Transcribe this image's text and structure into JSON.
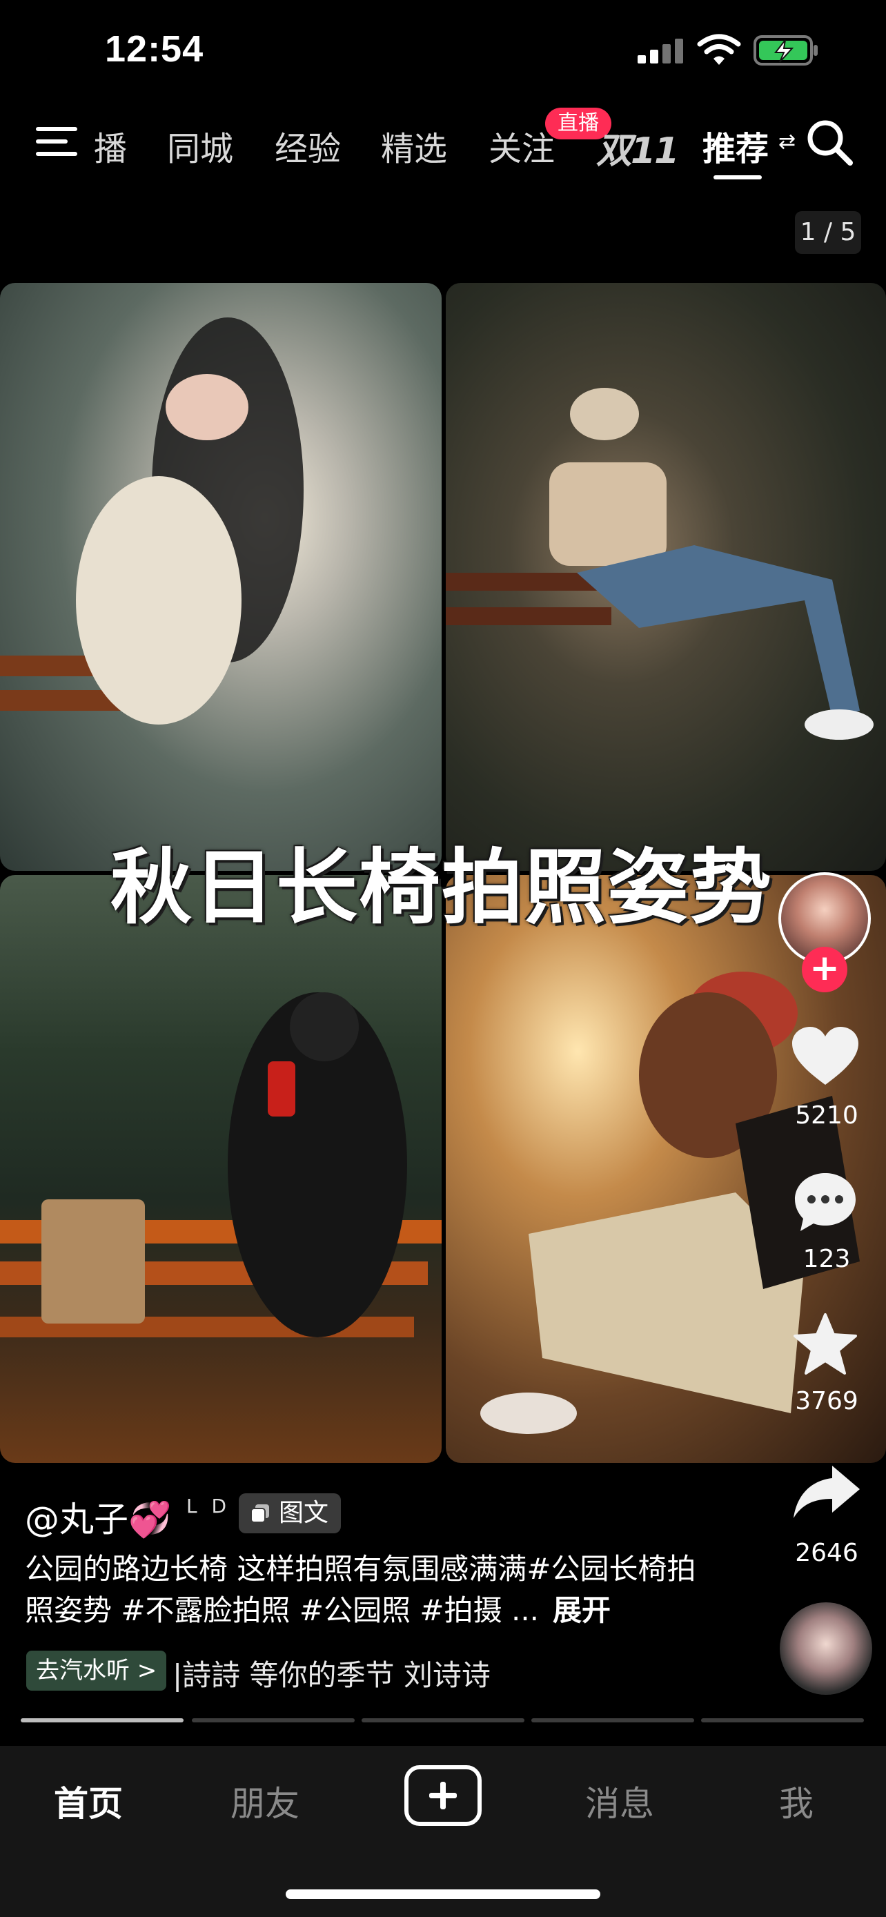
{
  "status_bar": {
    "time": "12:54"
  },
  "top_nav": {
    "tabs": [
      {
        "label": "播"
      },
      {
        "label": "同城"
      },
      {
        "label": "经验"
      },
      {
        "label": "精选"
      },
      {
        "label": "关注"
      },
      {
        "label": "推荐"
      }
    ],
    "live_badge": "直播",
    "promo_label": "双11",
    "active_tab": "推荐"
  },
  "post": {
    "page_counter": "1 / 5",
    "overlay_title": "秋日长椅拍照姿势",
    "author_name": "@丸子💞",
    "author_tag": "L D",
    "post_type": "图文",
    "caption": "公园的路边长椅 这样拍照有氛围感满满#公园长椅拍照姿势 #不露脸拍照 #公园照 #拍摄 ...",
    "caption_more": "展开",
    "music_link": "去汽水听 >",
    "music_title": "|詩詩  等你的季节 刘诗诗",
    "progress": {
      "segments": 5,
      "current": 1
    }
  },
  "actions": {
    "likes": "5210",
    "comments": "123",
    "favorites": "3769",
    "shares": "2646"
  },
  "bottom_nav": {
    "items": [
      {
        "label": "首页"
      },
      {
        "label": "朋友"
      },
      {
        "label": "消息"
      },
      {
        "label": "我"
      }
    ],
    "active": "首页"
  },
  "colors": {
    "accent": "#fe2c55",
    "background": "#000000",
    "nav_background": "#161616"
  }
}
